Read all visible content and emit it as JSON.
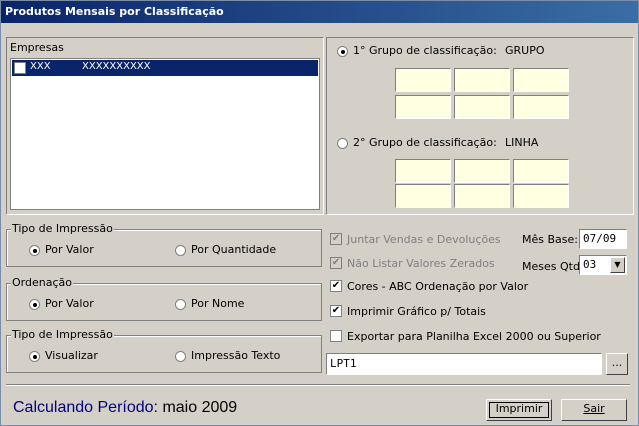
{
  "window": {
    "title": "Produtos Mensais por Classificação"
  },
  "empresas": {
    "label": "Empresas",
    "items": [
      {
        "code": "XXX",
        "name": "XXXXXXXXXX",
        "checked": false,
        "selected": true
      }
    ]
  },
  "grupos": {
    "grupo1": {
      "label": "1° Grupo de classificação:",
      "value": "GRUPO",
      "selected": true
    },
    "grupo2": {
      "label": "2° Grupo de classificação:",
      "value": "LINHA",
      "selected": false
    }
  },
  "tipo_impressao_1": {
    "label": "Tipo de Impressão",
    "opt_a": "Por Valor",
    "opt_b": "Por Quantidade",
    "selected": "a"
  },
  "ordenacao": {
    "label": "Ordenação",
    "opt_a": "Por Valor",
    "opt_b": "Por Nome",
    "selected": "a"
  },
  "tipo_impressao_2": {
    "label": "Tipo de Impressão",
    "opt_a": "Visualizar",
    "opt_b": "Impressão Texto",
    "selected": "a"
  },
  "options": {
    "juntar": {
      "label": "Juntar Vendas e Devoluções",
      "checked": true,
      "enabled": false
    },
    "nao_listar": {
      "label": "Não Listar Valores Zerados",
      "checked": true,
      "enabled": false
    },
    "cores_abc": {
      "label": "Cores - ABC Ordenação por Valor",
      "checked": true
    },
    "grafico": {
      "label": "Imprimir Gráfico p/ Totais",
      "checked": true
    },
    "excel": {
      "label": "Exportar para Planilha Excel 2000 ou Superior",
      "checked": false
    }
  },
  "mes_base": {
    "label": "Mês Base:",
    "value": "07/09"
  },
  "meses_qtd": {
    "label": "Meses Qtd:",
    "value": "03"
  },
  "printer": {
    "value": "LPT1",
    "browse_label": "..."
  },
  "status": {
    "prefix": "Calculando Período",
    "sep": ":",
    "value": "maio 2009"
  },
  "buttons": {
    "imprimir": "Imprimir",
    "sair": "Sair"
  },
  "colors": {
    "title_start": "#0a246a",
    "title_end": "#3a6ea5",
    "status_blue": "#00007f",
    "yellow_box": "#ffffe1",
    "selection": "#0a246a"
  }
}
